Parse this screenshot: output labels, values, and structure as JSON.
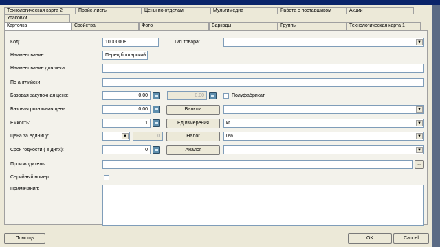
{
  "tabs_top_row": [
    "Технологическая карта 2",
    "Прайс-листы",
    "Цены по отделам",
    "Мультимедиа",
    "Работа с поставщиком",
    "Акции"
  ],
  "tabs_middle_row": [
    "Упаковки"
  ],
  "tabs_bottom_row": [
    "Карточка",
    "Свойства",
    "Фото",
    "Баркоды",
    "Группы",
    "Технологическая карта 1"
  ],
  "form": {
    "code_label": "Код:",
    "code_value": "10000008",
    "product_type_label": "Тип товара:",
    "product_type_value": "",
    "name_label": "Наименование:",
    "name_value": "Перец болгарский",
    "receipt_name_label": "Наименование для чека:",
    "receipt_name_value": "",
    "english_label": "По английски:",
    "english_value": "",
    "base_purchase_label": "Базовая закупочная цена:",
    "base_purchase_value": "0,00",
    "base_purchase_alt_value": "0,00",
    "semi_product_label": "Полуфабрикат",
    "base_retail_label": "Базовая розничная цена:",
    "base_retail_value": "0,00",
    "currency_button": "Валюта",
    "currency_value": "",
    "capacity_label": "Емкость:",
    "capacity_value": "1",
    "unit_button": "Ед.измерения",
    "unit_value": "кг",
    "unit_price_label": "Цена за единицу:",
    "unit_price_select": "",
    "unit_price_value": "0",
    "tax_button": "Налог",
    "tax_value": "0%",
    "shelf_life_label": "Срок годности ( в днях):",
    "shelf_life_value": "0",
    "analog_button": "Аналог",
    "analog_value": "",
    "manufacturer_label": "Производитель:",
    "manufacturer_value": "",
    "manufacturer_browse": "...",
    "serial_label": "Серийный номер:",
    "notes_label": "Примечания:",
    "notes_value": ""
  },
  "footer": {
    "help_button": "Помощь",
    "ok_button": "OK",
    "cancel_button": "Cancel"
  }
}
